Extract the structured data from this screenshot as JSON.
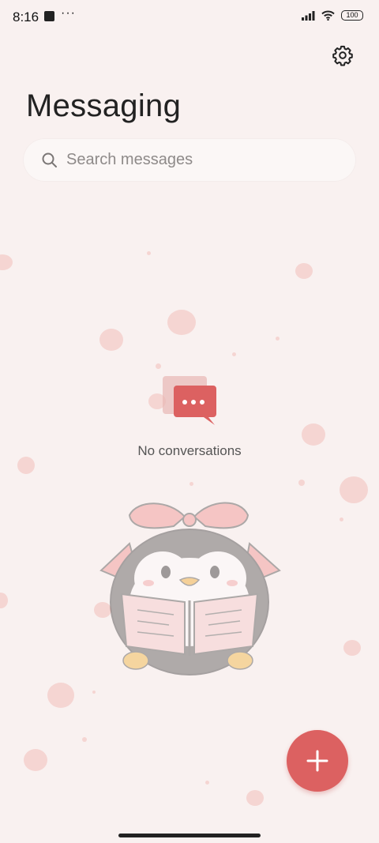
{
  "status_bar": {
    "time": "8:16",
    "dots": "···",
    "battery": "100"
  },
  "header": {
    "title": "Messaging",
    "settings_icon": "gear-icon"
  },
  "search": {
    "placeholder": "Search messages",
    "icon": "search-icon"
  },
  "empty_state": {
    "icon": "chat-bubble-icon",
    "text": "No conversations"
  },
  "fab": {
    "icon": "plus-icon"
  },
  "colors": {
    "accent": "#dc6161",
    "background": "#f9f1f0"
  }
}
